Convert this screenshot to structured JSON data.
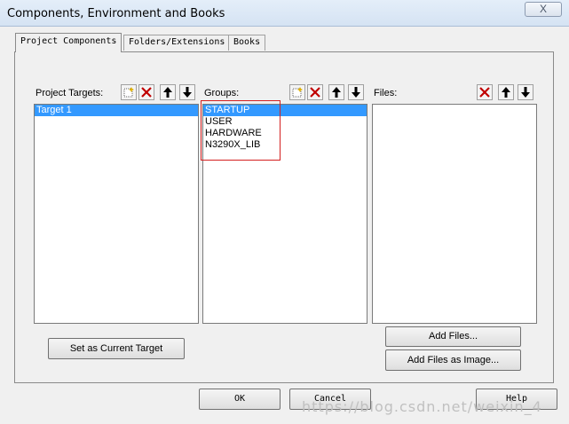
{
  "window": {
    "title": "Components, Environment and Books",
    "close_label": "X"
  },
  "tabs": [
    {
      "label": "Project Components"
    },
    {
      "label": "Folders/Extensions"
    },
    {
      "label": "Books"
    }
  ],
  "targets": {
    "label": "Project Targets:",
    "items": [
      "Target 1"
    ],
    "selected": "Target 1"
  },
  "groups": {
    "label": "Groups:",
    "items": [
      "STARTUP",
      "USER",
      "HARDWARE",
      "N3290X_LIB"
    ],
    "selected": "STARTUP"
  },
  "files": {
    "label": "Files:",
    "items": []
  },
  "buttons": {
    "set_current": "Set as Current Target",
    "add_files": "Add Files...",
    "add_files_image": "Add Files as Image...",
    "ok": "OK",
    "cancel": "Cancel",
    "help": "Help"
  },
  "watermark": "https://blog.csdn.net/weixin_4",
  "icons": {
    "new": "new-item-icon",
    "delete": "delete-icon",
    "up": "move-up-icon",
    "down": "move-down-icon"
  },
  "colors": {
    "selection": "#3399ff",
    "delete_red": "#c00000",
    "annotation_red": "#d42020"
  }
}
